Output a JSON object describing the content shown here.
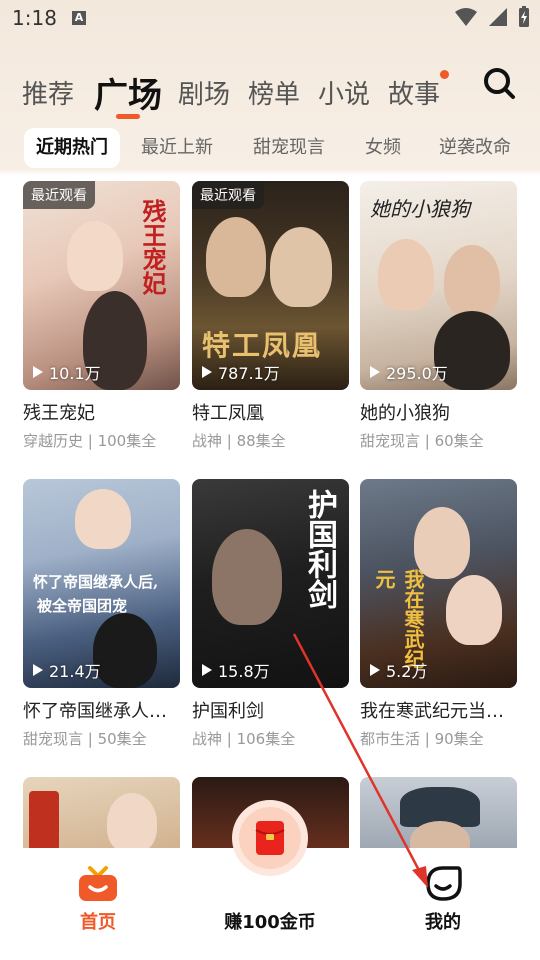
{
  "status_bar": {
    "time": "1:18",
    "indicator": "A"
  },
  "main_tabs": [
    {
      "label": "推荐"
    },
    {
      "label": "广场"
    },
    {
      "label": "剧场"
    },
    {
      "label": "榜单"
    },
    {
      "label": "小说"
    },
    {
      "label": "故事"
    }
  ],
  "sub_tabs": [
    {
      "label": "近期热门"
    },
    {
      "label": "最近上新"
    },
    {
      "label": "甜宠现言"
    },
    {
      "label": "女频"
    },
    {
      "label": "逆袭改命"
    }
  ],
  "cards": [
    {
      "badge": "最近观看",
      "plays": "10.1万",
      "title": "残王宠妃",
      "meta": "穿越历史 | 100集全"
    },
    {
      "badge": "最近观看",
      "plays": "787.1万",
      "title": "特工凤凰",
      "meta": "战神 | 88集全"
    },
    {
      "badge": "",
      "plays": "295.0万",
      "title": "她的小狼狗",
      "meta": "甜宠现言 | 60集全"
    },
    {
      "badge": "",
      "plays": "21.4万",
      "title": "怀了帝国继承人…",
      "meta": "甜宠现言 | 50集全"
    },
    {
      "badge": "",
      "plays": "15.8万",
      "title": "护国利剑",
      "meta": "战神 | 106集全"
    },
    {
      "badge": "",
      "plays": "5.2万",
      "title": "我在寒武纪元当…",
      "meta": "都市生活 | 90集全"
    }
  ],
  "poster_texts": {
    "p1": "残王宠妃",
    "p2": "特工凤凰",
    "p3": "她的小狼狗",
    "p4_line1": "怀了帝国继承人后,",
    "p4_line2": "被全帝国团宠",
    "p5": "护国利剑",
    "p6": "我在寒武纪元"
  },
  "bottom_nav": {
    "home": "首页",
    "earn": "赚100金币",
    "mine": "我的"
  },
  "colors": {
    "accent": "#f05a28"
  }
}
